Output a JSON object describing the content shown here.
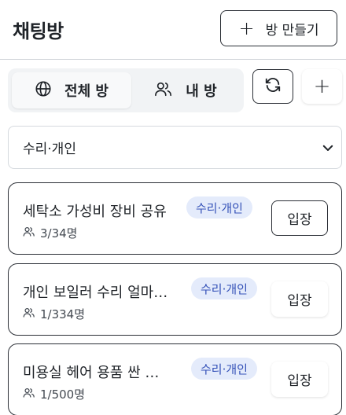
{
  "header": {
    "title": "채팅방",
    "create_button_label": "방 만들기",
    "create_button_icon": "plus-icon"
  },
  "segment": {
    "tabs": [
      {
        "label": "전체 방",
        "icon": "globe-icon",
        "active": true
      },
      {
        "label": "내 방",
        "icon": "users-icon",
        "active": false
      }
    ]
  },
  "actions": {
    "refresh_icon": "refresh-icon",
    "add_label": "+"
  },
  "filter": {
    "selected": "수리·개인",
    "icon": "chevron-down-icon"
  },
  "rooms": [
    {
      "name": "세탁소 가성비 장비 공유",
      "category": "수리·개인",
      "members": "3/34명",
      "button": "입장"
    },
    {
      "name": "개인 보일러 수리 얼마…",
      "category": "수리·개인",
      "members": "1/334명",
      "button": "입장"
    },
    {
      "name": "미용실 헤어 용품 싼 …",
      "category": "수리·개인",
      "members": "1/500명",
      "button": "입장"
    }
  ]
}
